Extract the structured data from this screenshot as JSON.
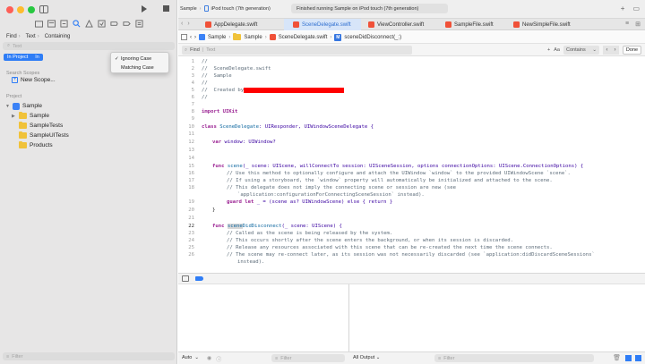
{
  "window": {
    "title": "Sample"
  },
  "sidebar": {
    "find_mode": {
      "find": "Find",
      "text": "Text",
      "containing": "Containing"
    },
    "search_placeholder": "Text",
    "scope_pill": {
      "label": "In Project",
      "trailing": "In"
    },
    "dropdown": {
      "items": [
        {
          "label": "Ignoring Case",
          "checked": true
        },
        {
          "label": "Matching Case",
          "checked": false
        }
      ]
    },
    "search_scopes_header": "Search Scopes",
    "new_scope_label": "New Scope...",
    "project_header": "Project",
    "tree": [
      {
        "label": "Sample",
        "kind": "project",
        "expanded": true
      },
      {
        "label": "Sample",
        "kind": "folder"
      },
      {
        "label": "SampleTests",
        "kind": "folder"
      },
      {
        "label": "SampleUITests",
        "kind": "folder"
      },
      {
        "label": "Products",
        "kind": "folder"
      }
    ],
    "filter_placeholder": "Filter"
  },
  "toolbar": {
    "scheme": "Sample",
    "device": "iPod touch (7th generation)",
    "status": "Finished running Sample on iPod touch (7th generation)"
  },
  "tabs": [
    {
      "label": "AppDelegate.swift",
      "active": false
    },
    {
      "label": "SceneDelegate.swift",
      "active": true
    },
    {
      "label": "ViewController.swift",
      "active": false
    },
    {
      "label": "SampleFile.swift",
      "active": false
    },
    {
      "label": "NewSimpleFile.swift",
      "active": false
    }
  ],
  "jumpbar": {
    "items": [
      "Sample",
      "Sample",
      "SceneDelegate.swift",
      "sceneDidDisconnect(_:)"
    ]
  },
  "findbar": {
    "mode": "Find",
    "placeholder": "Text",
    "aa": "Aa",
    "contains": "Contains",
    "done": "Done"
  },
  "code": {
    "line_numbers": [
      "1",
      "2",
      "3",
      "4",
      "5",
      "6",
      "7",
      "8",
      "9",
      "10",
      "11",
      "12",
      "13",
      "14",
      "15",
      "16",
      "17",
      "18",
      "19",
      "20",
      "21",
      "22",
      "23",
      "24",
      "25",
      "26",
      "27"
    ],
    "current_line": "22",
    "lines": {
      "l1": "//",
      "l2": "//  SceneDelegate.swift",
      "l3": "//  Sample",
      "l4": "//",
      "l5": "//  Created by",
      "l6": "//",
      "l7": "import UIKit",
      "l8_kw": "class",
      "l8_name": "SceneDelegate",
      "l8_rest": ": UIResponder, UIWindowSceneDelegate {",
      "l9_kw": "var",
      "l9_rest": "window: UIWindow?",
      "l10_kw": "func",
      "l10_name": "scene",
      "l10_rest": "(_ scene: UIScene, willConnectTo session: UISceneSession, options connectionOptions: UIScene.ConnectionOptions) {",
      "l11": "// Use this method to optionally configure and attach the UIWindow `window` to the provided UIWindowScene `scene`.",
      "l12": "// If using a storyboard, the `window` property will automatically be initialized and attached to the scene.",
      "l13": "// This delegate does not imply the connecting scene or session are new (see",
      "l14": "`application:configurationForConnectingSceneSession` instead).",
      "l15_kw": "guard let",
      "l15_rest": "_ = (scene as? UIWindowScene) else { return }",
      "l16": "}",
      "l17_kw": "func",
      "l17_hl": "scene",
      "l17_name": "DidDisconnect",
      "l17_rest": "(_ scene: UIScene) {",
      "l18": "// Called as the scene is being released by the system.",
      "l19": "// This occurs shortly after the scene enters the background, or when its session is discarded.",
      "l20": "// Release any resources associated with this scene that can be re-created the next time the scene connects.",
      "l21": "// The scene may re-connect later, as its session was not necessarily discarded (see `application:didDiscardSceneSessions`",
      "l22": "instead)."
    }
  },
  "debug": {
    "auto_label": "Auto",
    "left_filter": "Filter",
    "output_label": "All Output",
    "right_filter": "Filter"
  },
  "colors": {
    "accent": "#2f7df6",
    "redaction": "#ff0000",
    "keyword": "#9b2393",
    "comment": "#5d6c79"
  }
}
